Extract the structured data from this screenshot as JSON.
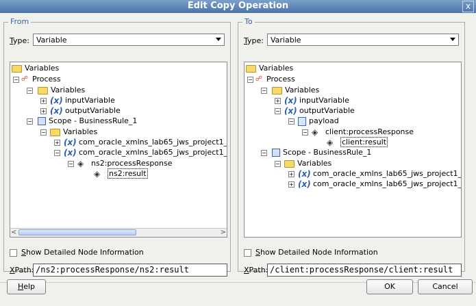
{
  "window": {
    "title": "Edit Copy Operation",
    "close_glyph": "x"
  },
  "from": {
    "legend": "From",
    "type_label_u": "T",
    "type_label_rest": "ype:",
    "type_value": "Variable",
    "tree": [
      {
        "label": "Variables",
        "icon": "folder"
      },
      {
        "label": "Process",
        "icon": "process"
      },
      {
        "label": "Variables",
        "icon": "folder"
      },
      {
        "label": "inputVariable",
        "icon": "variable"
      },
      {
        "label": "outputVariable",
        "icon": "variable"
      },
      {
        "label": "Scope - BusinessRule_1",
        "icon": "scope"
      },
      {
        "label": "Variables",
        "icon": "folder"
      },
      {
        "label": "com_oracle_xmlns_lab65_jws_project1_",
        "icon": "variable"
      },
      {
        "label": "com_oracle_xmlns_lab65_jws_project1_",
        "icon": "variable"
      },
      {
        "label": "ns2:processResponse",
        "icon": "element"
      },
      {
        "label": "ns2:result",
        "icon": "element"
      }
    ],
    "show_detail_u": "S",
    "show_detail_rest": "how Detailed Node Information",
    "xpath_label_u": "X",
    "xpath_label_rest": "Path:",
    "xpath_value": "/ns2:processResponse/ns2:result"
  },
  "to": {
    "legend": "To",
    "type_label_u": "T",
    "type_label_rest": "ype:",
    "type_value": "Variable",
    "tree": [
      {
        "label": "Variables",
        "icon": "folder"
      },
      {
        "label": "Process",
        "icon": "process"
      },
      {
        "label": "Variables",
        "icon": "folder"
      },
      {
        "label": "inputVariable",
        "icon": "variable"
      },
      {
        "label": "outputVariable",
        "icon": "variable"
      },
      {
        "label": "payload",
        "icon": "payload"
      },
      {
        "label": "client:processResponse",
        "icon": "element"
      },
      {
        "label": "client:result",
        "icon": "element"
      },
      {
        "label": "Scope - BusinessRule_1",
        "icon": "scope"
      },
      {
        "label": "Variables",
        "icon": "folder"
      },
      {
        "label": "com_oracle_xmlns_lab65_jws_project1_",
        "icon": "variable"
      },
      {
        "label": "com_oracle_xmlns_lab65_jws_project1_",
        "icon": "variable"
      }
    ],
    "show_detail_u": "S",
    "show_detail_rest": "how Detailed Node Information",
    "xpath_label_u": "X",
    "xpath_label_rest": "Path:",
    "xpath_value": "/client:processResponse/client:result"
  },
  "buttons": {
    "help_u": "H",
    "help_rest": "elp",
    "ok": "OK",
    "cancel": "Cancel"
  },
  "colors": {
    "title_bar": "#4a74a8",
    "legend": "#3c64a0",
    "folder": "#f5d96b",
    "variable": "#2a5fb0"
  }
}
